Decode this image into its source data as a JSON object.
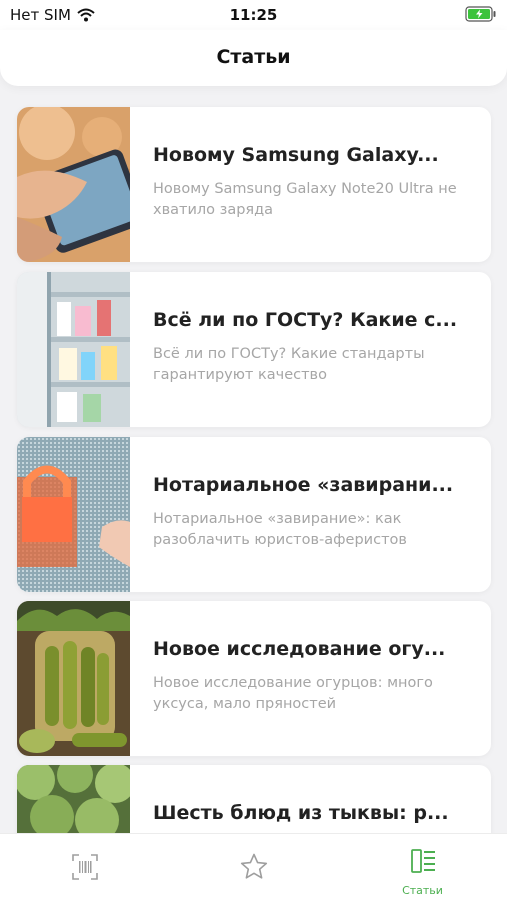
{
  "status_bar": {
    "carrier": "Нет SIM",
    "time": "11:25"
  },
  "header": {
    "title": "Статьи"
  },
  "articles": [
    {
      "title": "Новому Samsung Galaxy...",
      "description": "Новому Samsung Galaxy Note20 Ultra не хватило заряда",
      "image": "hand-holding-smartphone-photo"
    },
    {
      "title": "Всё ли по ГОСТу? Какие с...",
      "description": "Всё ли по ГОСТу? Какие стандарты гарантируют качество",
      "image": "supermarket-fridge-shelves-photo"
    },
    {
      "title": "Нотариальное «завирани...",
      "description": "Нотариальное «завирание»: как разоблачить юристов-аферистов",
      "image": "digital-padlock-screen-photo"
    },
    {
      "title": "Новое исследование огу...",
      "description": "Новое исследование огурцов: много уксуса, мало пряностей",
      "image": "pickled-cucumbers-jar-photo"
    },
    {
      "title": "Шесть блюд из тыквы: р...",
      "description": "",
      "image": "green-squash-pile-photo"
    }
  ],
  "tab_bar": {
    "tabs": [
      {
        "icon": "barcode-scanner-icon",
        "label": ""
      },
      {
        "icon": "star-icon",
        "label": ""
      },
      {
        "icon": "articles-list-icon",
        "label": "Статьи"
      }
    ],
    "active_color": "#4caf50",
    "inactive_color": "#9e9e9e"
  },
  "colors": {
    "accent": "#4caf50",
    "background": "#f2f2f4"
  }
}
